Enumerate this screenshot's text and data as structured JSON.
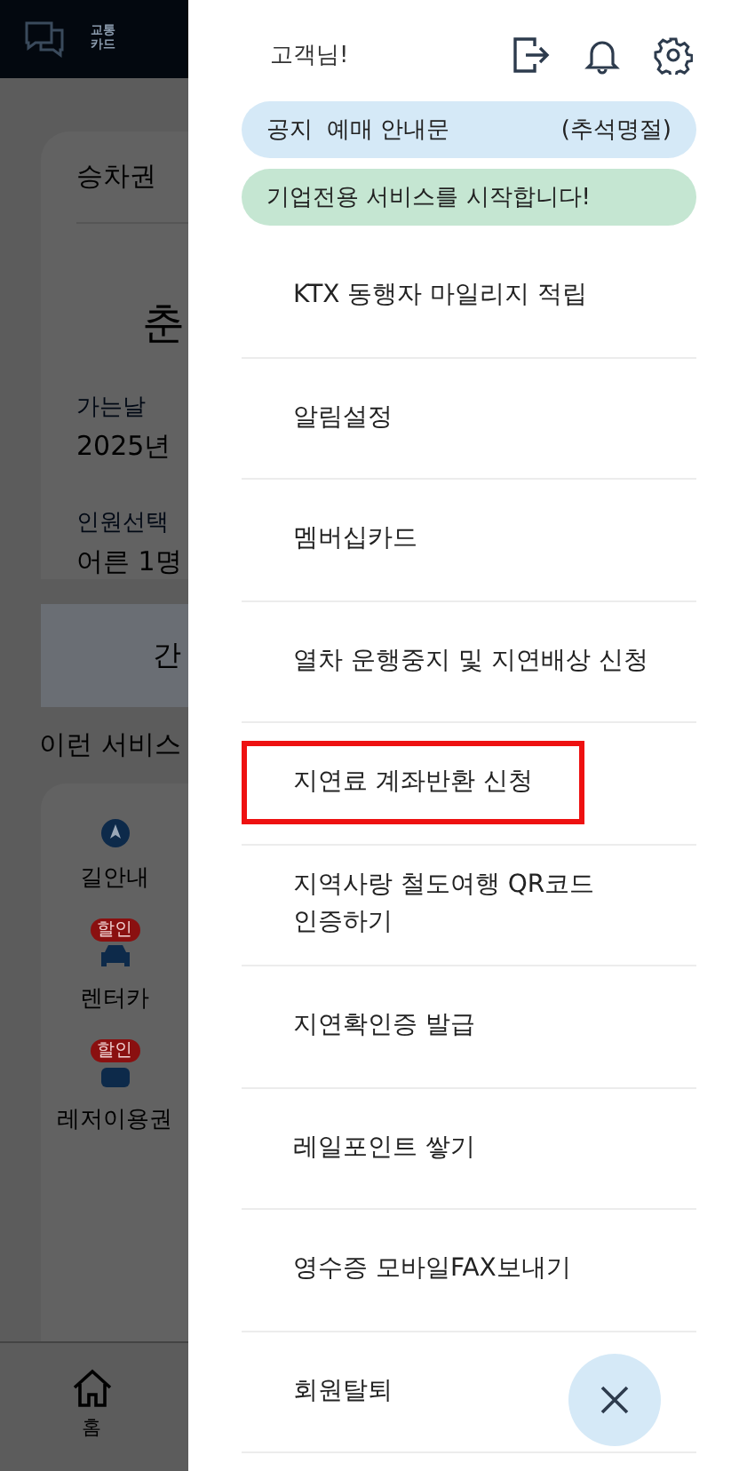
{
  "background": {
    "logo_text": "교통\n카드",
    "tab": "승차권",
    "station": "춘",
    "date_label": "가는날",
    "date_value": "2025년",
    "people_label": "인원선택",
    "people_value": "어른 1명",
    "search_button": "간",
    "services_title": "이런 서비스",
    "services": [
      {
        "kind": "navigation",
        "label": "길안내"
      },
      {
        "kind": "car",
        "label": "렌터카",
        "badge": "할인"
      },
      {
        "kind": "leisure",
        "label": "레저이용권",
        "badge": "할인"
      }
    ],
    "nav_home": "홈"
  },
  "drawer": {
    "greeting": "고객님!",
    "notices": [
      {
        "kind": "notice",
        "tag": "공지",
        "text": "예매 안내문",
        "extra": "(추석명절)"
      },
      {
        "kind": "promo",
        "text": "기업전용 서비스를 시작합니다!"
      }
    ],
    "menu": [
      {
        "label": "KTX 동행자 마일리지 적립",
        "highlighted": false
      },
      {
        "label": "알림설정",
        "highlighted": false
      },
      {
        "label": "멤버십카드",
        "highlighted": false
      },
      {
        "label": "열차 운행중지 및 지연배상 신청",
        "highlighted": false
      },
      {
        "label": "지연료 계좌반환 신청",
        "highlighted": true
      },
      {
        "label": "지역사랑 철도여행 QR코드\n인증하기",
        "highlighted": false
      },
      {
        "label": "지연확인증 발급",
        "highlighted": false
      },
      {
        "label": "레일포인트 쌓기",
        "highlighted": false
      },
      {
        "label": "영수증 모바일FAX보내기",
        "highlighted": false
      },
      {
        "label": "회원탈퇴",
        "highlighted": false
      }
    ]
  }
}
